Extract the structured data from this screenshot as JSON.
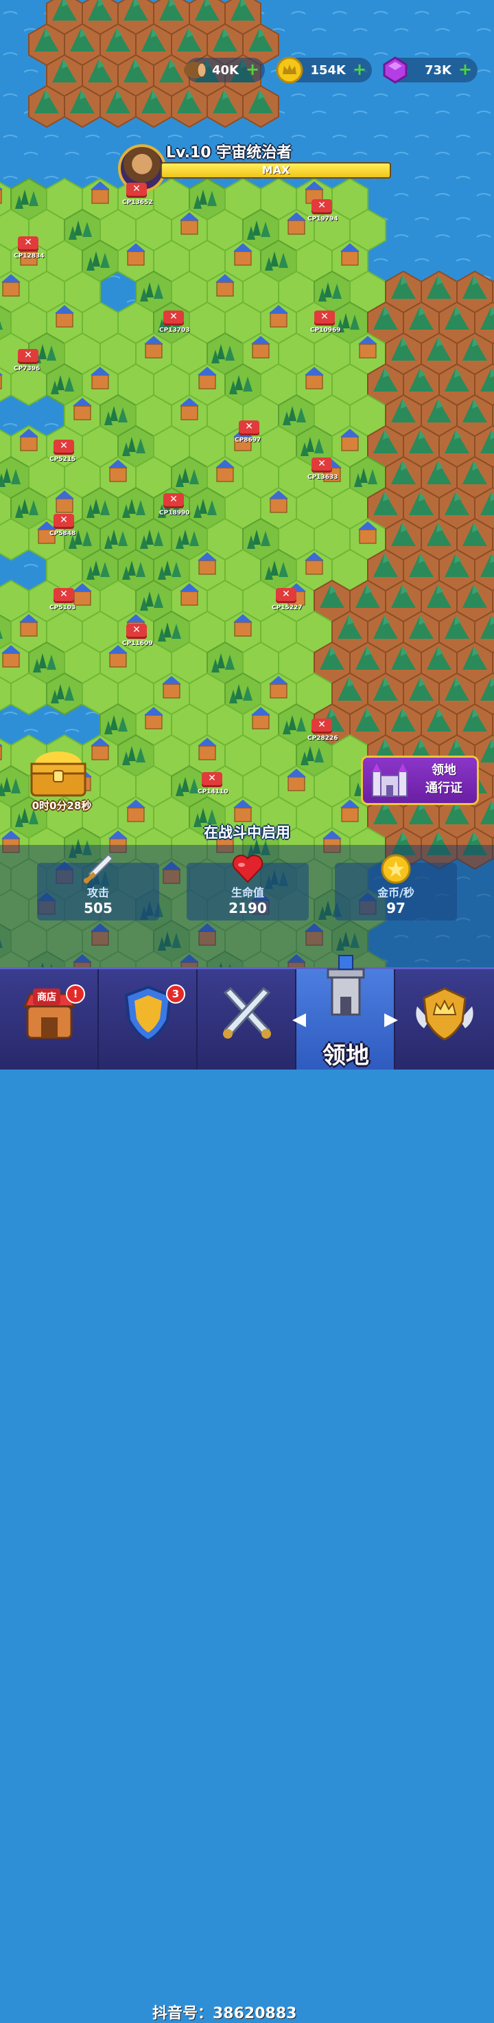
{
  "resources": [
    {
      "name": "wood",
      "value": "40K",
      "icon": "log-icon",
      "color": "#8a5a2b"
    },
    {
      "name": "gold",
      "value": "154K",
      "icon": "crown-coin-icon",
      "color": "#f5c518"
    },
    {
      "name": "gems",
      "value": "73K",
      "icon": "gem-icon",
      "color": "#b43ee6"
    }
  ],
  "player": {
    "title": "Lv.10 宇宙统治者",
    "xp_label": "MAX",
    "xp_fraction": 1.0
  },
  "enemy_camps": [
    {
      "cp": "CP13652"
    },
    {
      "cp": "CP19794"
    },
    {
      "cp": "CP12834"
    },
    {
      "cp": "CP13703"
    },
    {
      "cp": "CP10969"
    },
    {
      "cp": "CP7396"
    },
    {
      "cp": "CP8697"
    },
    {
      "cp": "CP5215"
    },
    {
      "cp": "CP13633"
    },
    {
      "cp": "CP18990"
    },
    {
      "cp": "CP5848"
    },
    {
      "cp": "CP5103"
    },
    {
      "cp": "CP15227"
    },
    {
      "cp": "CP11609"
    },
    {
      "cp": "CP28226"
    },
    {
      "cp": "CP14110"
    }
  ],
  "chest": {
    "timer": "0时0分28秒"
  },
  "territory_pass": {
    "line1": "领地",
    "line2": "通行证"
  },
  "battle_note": "在战斗中启用",
  "stats": [
    {
      "label": "攻击",
      "value": "505",
      "icon": "sword-icon"
    },
    {
      "label": "生命值",
      "value": "2190",
      "icon": "heart-icon"
    },
    {
      "label": "金币/秒",
      "value": "97",
      "icon": "gold-coin-icon"
    }
  ],
  "nav": {
    "shop_label": "商店",
    "shop_badge": "!",
    "hero_badge": "3",
    "active_label": "领地",
    "watermark": "抖音号：38620883"
  }
}
